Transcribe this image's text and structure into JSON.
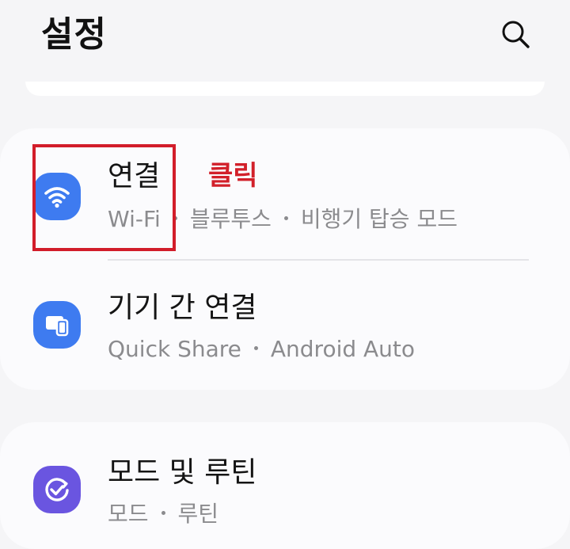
{
  "header": {
    "title": "설정",
    "search_icon": "search-icon"
  },
  "items": [
    {
      "title": "연결",
      "subs": [
        "Wi-Fi",
        "블루투스",
        "비행기 탑승 모드"
      ],
      "icon": "wifi-icon",
      "icon_color": "#3e7bf0"
    },
    {
      "title": "기기 간 연결",
      "subs": [
        "Quick Share",
        "Android Auto"
      ],
      "icon": "devices-icon",
      "icon_color": "#3e7bf0"
    },
    {
      "title": "모드 및 루틴",
      "subs": [
        "모드",
        "루틴"
      ],
      "icon": "routine-check-icon",
      "icon_color": "#6a55e0"
    }
  ],
  "annotation": {
    "label": "클릭",
    "color": "#d21d2a"
  }
}
